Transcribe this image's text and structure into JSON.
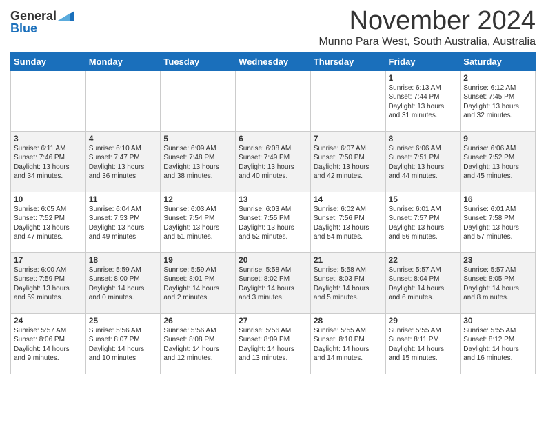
{
  "logo": {
    "general": "General",
    "blue": "Blue"
  },
  "title": "November 2024",
  "location": "Munno Para West, South Australia, Australia",
  "weekdays": [
    "Sunday",
    "Monday",
    "Tuesday",
    "Wednesday",
    "Thursday",
    "Friday",
    "Saturday"
  ],
  "weeks": [
    [
      {
        "day": "",
        "info": ""
      },
      {
        "day": "",
        "info": ""
      },
      {
        "day": "",
        "info": ""
      },
      {
        "day": "",
        "info": ""
      },
      {
        "day": "",
        "info": ""
      },
      {
        "day": "1",
        "info": "Sunrise: 6:13 AM\nSunset: 7:44 PM\nDaylight: 13 hours\nand 31 minutes."
      },
      {
        "day": "2",
        "info": "Sunrise: 6:12 AM\nSunset: 7:45 PM\nDaylight: 13 hours\nand 32 minutes."
      }
    ],
    [
      {
        "day": "3",
        "info": "Sunrise: 6:11 AM\nSunset: 7:46 PM\nDaylight: 13 hours\nand 34 minutes."
      },
      {
        "day": "4",
        "info": "Sunrise: 6:10 AM\nSunset: 7:47 PM\nDaylight: 13 hours\nand 36 minutes."
      },
      {
        "day": "5",
        "info": "Sunrise: 6:09 AM\nSunset: 7:48 PM\nDaylight: 13 hours\nand 38 minutes."
      },
      {
        "day": "6",
        "info": "Sunrise: 6:08 AM\nSunset: 7:49 PM\nDaylight: 13 hours\nand 40 minutes."
      },
      {
        "day": "7",
        "info": "Sunrise: 6:07 AM\nSunset: 7:50 PM\nDaylight: 13 hours\nand 42 minutes."
      },
      {
        "day": "8",
        "info": "Sunrise: 6:06 AM\nSunset: 7:51 PM\nDaylight: 13 hours\nand 44 minutes."
      },
      {
        "day": "9",
        "info": "Sunrise: 6:06 AM\nSunset: 7:52 PM\nDaylight: 13 hours\nand 45 minutes."
      }
    ],
    [
      {
        "day": "10",
        "info": "Sunrise: 6:05 AM\nSunset: 7:52 PM\nDaylight: 13 hours\nand 47 minutes."
      },
      {
        "day": "11",
        "info": "Sunrise: 6:04 AM\nSunset: 7:53 PM\nDaylight: 13 hours\nand 49 minutes."
      },
      {
        "day": "12",
        "info": "Sunrise: 6:03 AM\nSunset: 7:54 PM\nDaylight: 13 hours\nand 51 minutes."
      },
      {
        "day": "13",
        "info": "Sunrise: 6:03 AM\nSunset: 7:55 PM\nDaylight: 13 hours\nand 52 minutes."
      },
      {
        "day": "14",
        "info": "Sunrise: 6:02 AM\nSunset: 7:56 PM\nDaylight: 13 hours\nand 54 minutes."
      },
      {
        "day": "15",
        "info": "Sunrise: 6:01 AM\nSunset: 7:57 PM\nDaylight: 13 hours\nand 56 minutes."
      },
      {
        "day": "16",
        "info": "Sunrise: 6:01 AM\nSunset: 7:58 PM\nDaylight: 13 hours\nand 57 minutes."
      }
    ],
    [
      {
        "day": "17",
        "info": "Sunrise: 6:00 AM\nSunset: 7:59 PM\nDaylight: 13 hours\nand 59 minutes."
      },
      {
        "day": "18",
        "info": "Sunrise: 5:59 AM\nSunset: 8:00 PM\nDaylight: 14 hours\nand 0 minutes."
      },
      {
        "day": "19",
        "info": "Sunrise: 5:59 AM\nSunset: 8:01 PM\nDaylight: 14 hours\nand 2 minutes."
      },
      {
        "day": "20",
        "info": "Sunrise: 5:58 AM\nSunset: 8:02 PM\nDaylight: 14 hours\nand 3 minutes."
      },
      {
        "day": "21",
        "info": "Sunrise: 5:58 AM\nSunset: 8:03 PM\nDaylight: 14 hours\nand 5 minutes."
      },
      {
        "day": "22",
        "info": "Sunrise: 5:57 AM\nSunset: 8:04 PM\nDaylight: 14 hours\nand 6 minutes."
      },
      {
        "day": "23",
        "info": "Sunrise: 5:57 AM\nSunset: 8:05 PM\nDaylight: 14 hours\nand 8 minutes."
      }
    ],
    [
      {
        "day": "24",
        "info": "Sunrise: 5:57 AM\nSunset: 8:06 PM\nDaylight: 14 hours\nand 9 minutes."
      },
      {
        "day": "25",
        "info": "Sunrise: 5:56 AM\nSunset: 8:07 PM\nDaylight: 14 hours\nand 10 minutes."
      },
      {
        "day": "26",
        "info": "Sunrise: 5:56 AM\nSunset: 8:08 PM\nDaylight: 14 hours\nand 12 minutes."
      },
      {
        "day": "27",
        "info": "Sunrise: 5:56 AM\nSunset: 8:09 PM\nDaylight: 14 hours\nand 13 minutes."
      },
      {
        "day": "28",
        "info": "Sunrise: 5:55 AM\nSunset: 8:10 PM\nDaylight: 14 hours\nand 14 minutes."
      },
      {
        "day": "29",
        "info": "Sunrise: 5:55 AM\nSunset: 8:11 PM\nDaylight: 14 hours\nand 15 minutes."
      },
      {
        "day": "30",
        "info": "Sunrise: 5:55 AM\nSunset: 8:12 PM\nDaylight: 14 hours\nand 16 minutes."
      }
    ]
  ]
}
